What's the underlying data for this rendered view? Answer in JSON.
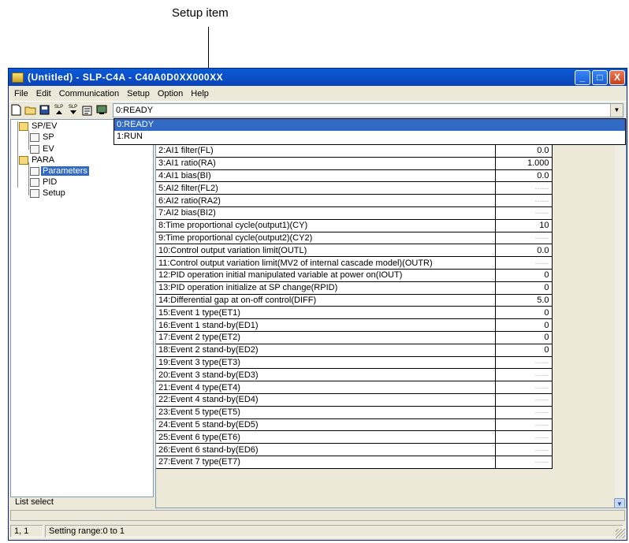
{
  "annotation": {
    "callout": "Setup item"
  },
  "window": {
    "title": "(Untitled) - SLP-C4A - C40A0D0XX000XX",
    "controls": [
      "_",
      "□",
      "X"
    ]
  },
  "menu": [
    "File",
    "Edit",
    "Communication",
    "Setup",
    "Option",
    "Help"
  ],
  "toolbar": {
    "icons": [
      "new-file-icon",
      "open-folder-icon",
      "save-icon",
      "upload-slp-icon",
      "download-slp-icon",
      "properties-icon",
      "monitor-icon"
    ],
    "labels": [
      "SLP",
      "SLP"
    ],
    "combo_value": "0:READY"
  },
  "dropdown": {
    "options": [
      "0:READY",
      "1:RUN"
    ],
    "selected_index": 0
  },
  "tree": {
    "nodes": [
      {
        "label": "SP/EV",
        "type": "folder"
      },
      {
        "label": "SP",
        "type": "doc"
      },
      {
        "label": "EV",
        "type": "doc"
      },
      {
        "label": "PARA",
        "type": "folder"
      },
      {
        "label": "Parameters",
        "type": "doc",
        "selected": true
      },
      {
        "label": "PID",
        "type": "doc"
      },
      {
        "label": "Setup",
        "type": "doc"
      }
    ],
    "footer_label": "List select"
  },
  "grid": {
    "rows": [
      {
        "name": "",
        "value": ""
      },
      {
        "name": "",
        "value": ""
      },
      {
        "name": "2:AI1 filter(FL)",
        "value": "0.0"
      },
      {
        "name": "3:AI1 ratio(RA)",
        "value": "1.000"
      },
      {
        "name": "4:AI1 bias(BI)",
        "value": "0.0"
      },
      {
        "name": "5:AI2 filter(FL2)",
        "value": "------"
      },
      {
        "name": "6:AI2 ratio(RA2)",
        "value": "------"
      },
      {
        "name": "7:AI2 bias(BI2)",
        "value": "------"
      },
      {
        "name": "8:Time proportional cycle(output1)(CY)",
        "value": "10"
      },
      {
        "name": "9:Time proportional cycle(output2)(CY2)",
        "value": "------"
      },
      {
        "name": "10:Control output variation limit(OUTL)",
        "value": "0.0"
      },
      {
        "name": "11:Control output variation limit(MV2 of internal cascade model)(OUTR)",
        "value": "------"
      },
      {
        "name": "12:PID operation initial manipulated variable at power on(IOUT)",
        "value": "0"
      },
      {
        "name": "13:PID operation initialize at SP change(RPID)",
        "value": "0"
      },
      {
        "name": "14:Differential gap at on-off control(DIFF)",
        "value": "5.0"
      },
      {
        "name": "15:Event 1 type(ET1)",
        "value": "0"
      },
      {
        "name": "16:Event 1 stand-by(ED1)",
        "value": "0"
      },
      {
        "name": "17:Event 2 type(ET2)",
        "value": "0"
      },
      {
        "name": "18:Event 2 stand-by(ED2)",
        "value": "0"
      },
      {
        "name": "19:Event 3 type(ET3)",
        "value": "------"
      },
      {
        "name": "20:Event 3 stand-by(ED3)",
        "value": "------"
      },
      {
        "name": "21:Event 4 type(ET4)",
        "value": "------"
      },
      {
        "name": "22:Event 4 stand-by(ED4)",
        "value": "------"
      },
      {
        "name": "23:Event 5 type(ET5)",
        "value": "------"
      },
      {
        "name": "24:Event 5 stand-by(ED5)",
        "value": "------"
      },
      {
        "name": "25:Event 6 type(ET6)",
        "value": "------"
      },
      {
        "name": "26:Event 6 stand-by(ED6)",
        "value": "------"
      },
      {
        "name": "27:Event 7 type(ET7)",
        "value": "------"
      }
    ]
  },
  "status": {
    "position": "1, 1",
    "message": "Setting range:0 to 1"
  }
}
